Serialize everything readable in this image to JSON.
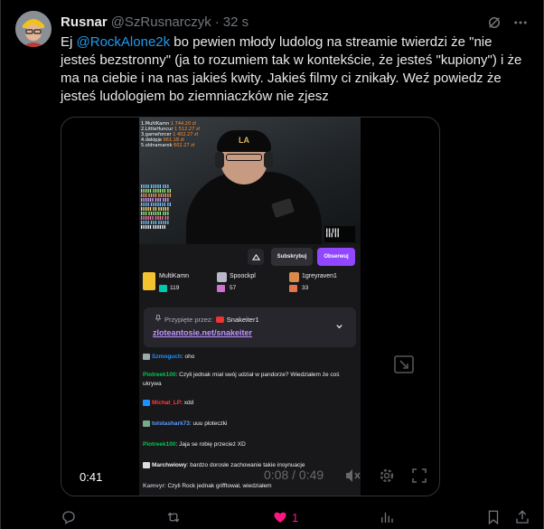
{
  "tweet": {
    "author_name": "Rusnar",
    "author_handle": "@SzRusnarczyk",
    "separator": "·",
    "time": "32 s",
    "text_mention": "@RockAlone2k",
    "text_body": " bo pewien młody ludolog na streamie twierdzi że \"nie jesteś bezstronny\" (ja to rozumiem tak w kontekście, że jesteś \"kupiony\") i że ma na ciebie i na nas jakieś kwity. Jakieś filmy ci znikały. Weź powiedz że jesteś ludologiem bo ziemniaczków nie zjesz",
    "text_prefix": "Ej ",
    "icons": {
      "grok": "grok-icon",
      "more": "more-dots-icon"
    }
  },
  "video": {
    "leaderboard": [
      {
        "name": "1.MultiKamn",
        "amount": "1 744.20 zł"
      },
      {
        "name": "2.LittleHuncur",
        "amount": "1 512.27 zł"
      },
      {
        "name": "3.gameforcer",
        "amount": "1 402.27 zł"
      },
      {
        "name": "4.dekipje",
        "amount": "961.18 zł"
      },
      {
        "name": "5.oldnamarok",
        "amount": "602.27 zł"
      }
    ],
    "cap_logo": "LA",
    "buttons": {
      "subscribe": "Subskrybuj",
      "follow": "Obserwuj"
    },
    "gifters": [
      {
        "name": "MultiKamn",
        "count": "119"
      },
      {
        "name": "Spoockpl",
        "count": "57"
      },
      {
        "name": "1greyraven1",
        "count": "33"
      }
    ],
    "pinned": {
      "label": "Przypięte przez:",
      "user": "Snakeiter1",
      "link": "zloteantosie.net/snakeiter"
    },
    "chat": [
      {
        "user": "Szmoguch",
        "sep": ":",
        "text": " oho",
        "color": "#1e90ff"
      },
      {
        "user": "Piotreek100",
        "sep": ":",
        "text": " Czyli jednak miał swój udział w pandorze? Wiedziałem że coś ukrywa",
        "color": "#00c853"
      },
      {
        "user": "Michał_LP",
        "sep": ":",
        "text": " xdd",
        "color": "#ff3b3b"
      },
      {
        "user": "tolstashark73",
        "sep": ":",
        "text": " uuu ploteczki",
        "color": "#5b9dff"
      },
      {
        "user": "Piotreek100",
        "sep": ":",
        "text": " Jaja se robię przecież XD",
        "color": "#00c853"
      },
      {
        "user": "Marchwiowy",
        "sep": ":",
        "text": " bardzo dorosłe zachowanie takie insynuacje",
        "color": "#efeff1"
      },
      {
        "user": "Kamvyr",
        "sep": ":",
        "text": " Czyli Rock jednak grifftował, wiedziałem",
        "color": "#adadb8"
      }
    ],
    "current_time": "0:41",
    "progress": "0:08 / 0:49"
  },
  "actions": {
    "likes": "1"
  },
  "colors": {
    "accent": "#1d9bf0",
    "like": "#f91880",
    "twitch_purple": "#9147ff",
    "link_purple": "#bf94ff"
  }
}
